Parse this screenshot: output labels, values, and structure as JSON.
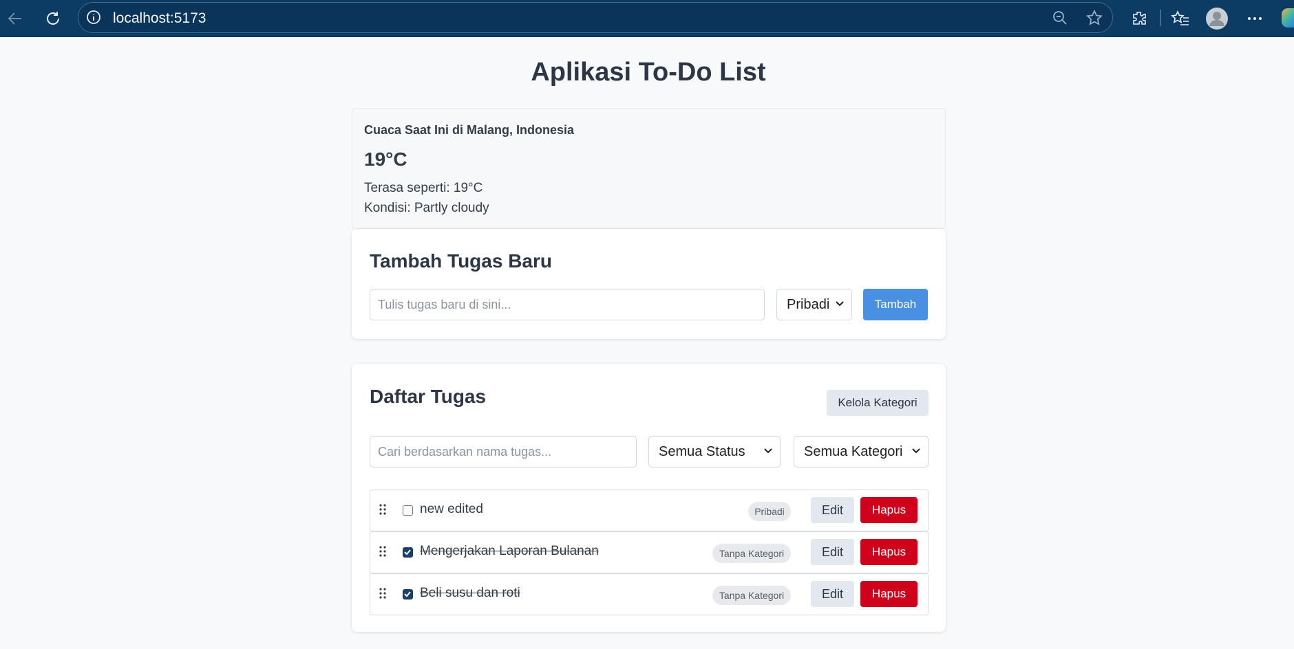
{
  "browser": {
    "url": "localhost:5173",
    "icons": [
      "back-icon",
      "reload-icon",
      "site-info-icon",
      "zoom-out-icon",
      "favorite-star-icon",
      "extensions-icon",
      "favorites-icon",
      "profile-icon",
      "more-icon"
    ]
  },
  "app": {
    "title": "Aplikasi To-Do List"
  },
  "weather": {
    "heading": "Cuaca Saat Ini di Malang, Indonesia",
    "temperature": "19°C",
    "feels_like": "Terasa seperti: 19°C",
    "condition": "Kondisi: Partly cloudy"
  },
  "add_task": {
    "heading": "Tambah Tugas Baru",
    "input_placeholder": "Tulis tugas baru di sini...",
    "input_value": "",
    "category_selected": "Pribadi",
    "submit_label": "Tambah"
  },
  "task_list": {
    "heading": "Daftar Tugas",
    "manage_categories_label": "Kelola Kategori",
    "search_placeholder": "Cari berdasarkan nama tugas...",
    "status_filter": "Semua Status",
    "category_filter": "Semua Kategori",
    "edit_label": "Edit",
    "delete_label": "Hapus",
    "items": [
      {
        "text": "new edited",
        "done": false,
        "category": "Pribadi"
      },
      {
        "text": "Mengerjakan Laporan Bulanan",
        "done": true,
        "category": "Tanpa Kategori"
      },
      {
        "text": "Beli susu dan roti",
        "done": true,
        "category": "Tanpa Kategori"
      }
    ]
  },
  "colors": {
    "browser_bar": "#0c3b63",
    "primary_button": "#4a90e2",
    "danger_button": "#d0021b",
    "checkbox_checked": "#1a3e6b"
  }
}
